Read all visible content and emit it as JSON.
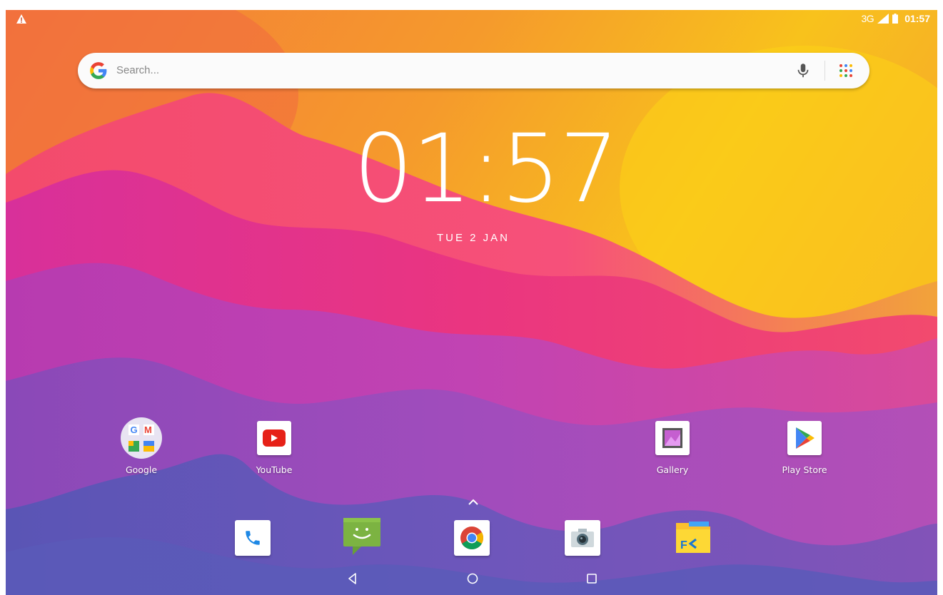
{
  "status_bar": {
    "network": "3G",
    "time": "01:57"
  },
  "search": {
    "placeholder": "Search..."
  },
  "clock": {
    "time": "01:57",
    "date": "TUE 2 JAN"
  },
  "home_apps": [
    {
      "label": "Google",
      "icon": "google-folder-icon"
    },
    {
      "label": "YouTube",
      "icon": "youtube-icon"
    },
    {
      "label": "Gallery",
      "icon": "gallery-icon"
    },
    {
      "label": "Play Store",
      "icon": "play-store-icon"
    }
  ],
  "dock": [
    {
      "icon": "phone-icon"
    },
    {
      "icon": "messaging-icon"
    },
    {
      "icon": "chrome-icon"
    },
    {
      "icon": "camera-icon"
    },
    {
      "icon": "file-manager-icon"
    }
  ],
  "navbar": [
    "back-icon",
    "home-icon",
    "recents-icon"
  ],
  "colors": {
    "youtube_red": "#e62117",
    "google_blue": "#4285f4",
    "google_red": "#ea4335",
    "google_yellow": "#fbbc05",
    "google_green": "#34a853"
  }
}
